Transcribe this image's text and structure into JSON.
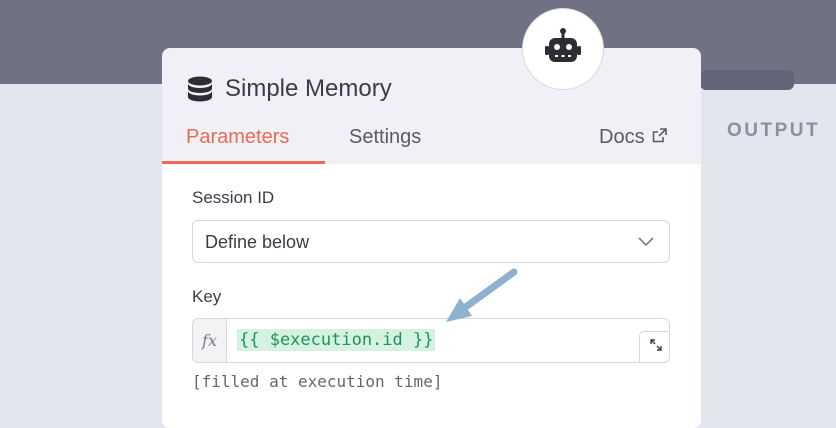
{
  "node": {
    "title": "Simple Memory",
    "icon": "database-icon",
    "badge_icon": "robot-icon"
  },
  "tabs": {
    "parameters": "Parameters",
    "settings": "Settings",
    "docs": "Docs"
  },
  "output_label": "OUTPUT",
  "session_id": {
    "label": "Session ID",
    "value": "Define below"
  },
  "key": {
    "label": "Key",
    "fx": "fx",
    "expression": "{{ $execution.id }}",
    "hint": "[filled at execution time]"
  },
  "colors": {
    "accent": "#ea6a52",
    "expression_text": "#1f9457",
    "expression_bg": "#d5f1e1",
    "annotation_arrow": "#8eb1d2"
  }
}
